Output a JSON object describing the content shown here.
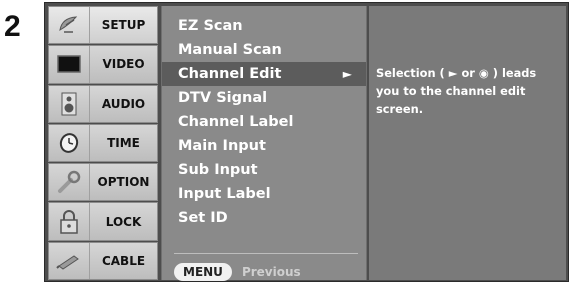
{
  "step_number": "2",
  "sidebar": {
    "items": [
      {
        "label": "SETUP",
        "icon": "satellite-dish-icon",
        "active": true
      },
      {
        "label": "VIDEO",
        "icon": "tv-icon",
        "active": false
      },
      {
        "label": "AUDIO",
        "icon": "speaker-icon",
        "active": false
      },
      {
        "label": "TIME",
        "icon": "clock-icon",
        "active": false
      },
      {
        "label": "OPTION",
        "icon": "wrench-icon",
        "active": false
      },
      {
        "label": "LOCK",
        "icon": "padlock-icon",
        "active": false
      },
      {
        "label": "CABLE",
        "icon": "cable-icon",
        "active": false
      }
    ]
  },
  "menu": {
    "items": [
      {
        "label": "EZ Scan"
      },
      {
        "label": "Manual Scan"
      },
      {
        "label": "Channel Edit",
        "selected": true,
        "arrow": "►"
      },
      {
        "label": "DTV Signal"
      },
      {
        "label": "Channel Label"
      },
      {
        "label": "Main Input"
      },
      {
        "label": "Sub Input"
      },
      {
        "label": "Input Label"
      },
      {
        "label": "Set ID"
      }
    ],
    "footer": {
      "button_label": "MENU",
      "action_label": "Previous"
    }
  },
  "description": {
    "text": "Selection ( ► or ◉ ) leads you to the channel edit screen."
  }
}
